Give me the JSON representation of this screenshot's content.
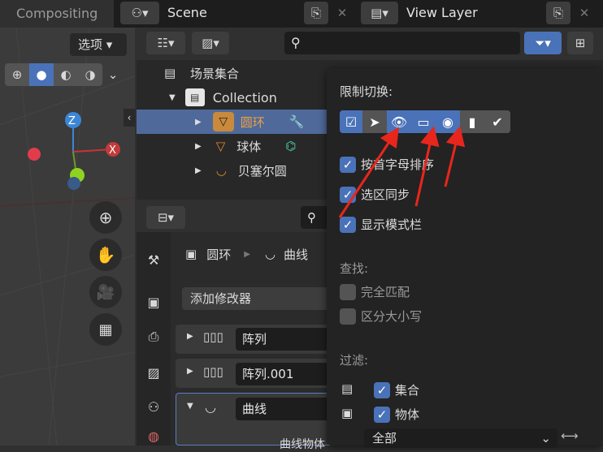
{
  "topbar": {
    "tab": "Compositing",
    "scene": "Scene",
    "view_layer": "View Layer"
  },
  "viewport": {
    "options": "选项",
    "axis_z": "Z",
    "axis_x": "X"
  },
  "outliner": {
    "items": [
      {
        "label": "场景集合"
      },
      {
        "label": "Collection"
      },
      {
        "label": "圆环"
      },
      {
        "label": "球体"
      },
      {
        "label": "贝塞尔圆"
      }
    ]
  },
  "properties": {
    "breadcrumb_obj": "圆环",
    "breadcrumb_data": "曲线",
    "add_modifier": "添加修改器",
    "modifiers": [
      {
        "name": "阵列"
      },
      {
        "name": "阵列.001"
      },
      {
        "name": "曲线"
      }
    ],
    "curve_object_label": "曲线物体"
  },
  "filter_popup": {
    "restrict_title": "限制切换:",
    "options": [
      {
        "label": "按首字母排序",
        "checked": true
      },
      {
        "label": "选区同步",
        "checked": true
      },
      {
        "label": "显示模式栏",
        "checked": true
      }
    ],
    "find_title": "查找:",
    "find_options": [
      {
        "label": "完全匹配",
        "checked": false
      },
      {
        "label": "区分大小写",
        "checked": false
      }
    ],
    "filter_title": "过滤:",
    "filter_options": [
      {
        "label": "集合",
        "checked": true
      },
      {
        "label": "物体",
        "checked": true
      }
    ],
    "filter_select": "全部"
  },
  "colors": {
    "accent": "#4a72b8",
    "selected_row": "#4f6a9a",
    "arrow": "#e8261c"
  }
}
